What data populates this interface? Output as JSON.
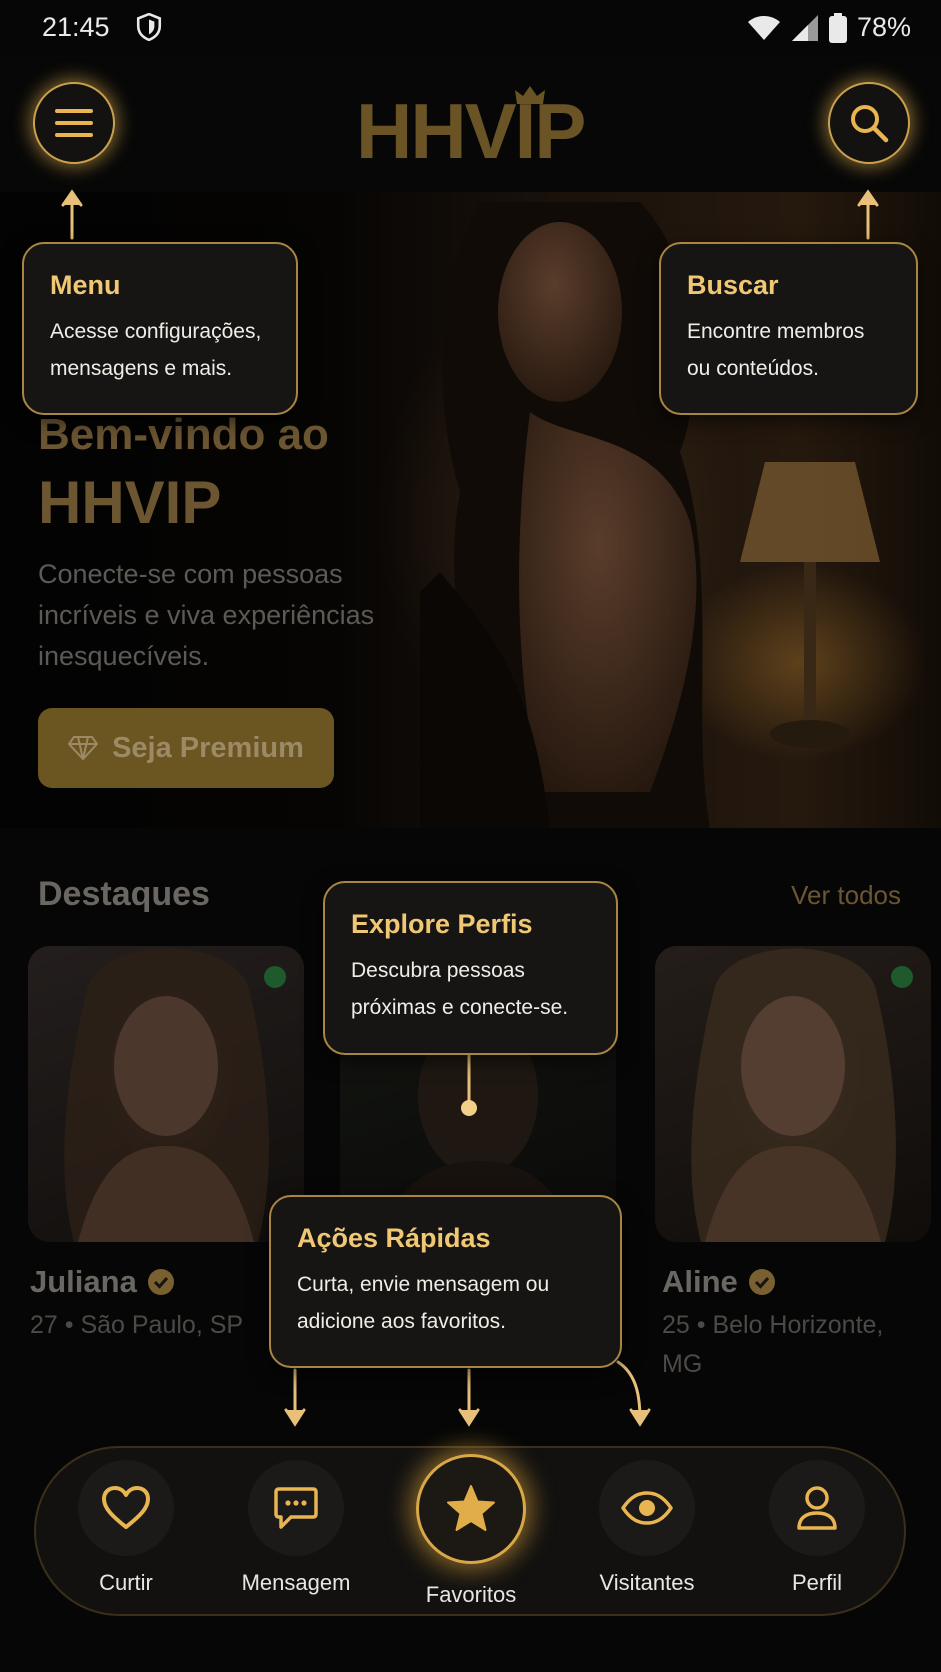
{
  "status_bar": {
    "time": "21:45",
    "battery": "78%"
  },
  "header": {
    "logo": "HHVIP",
    "menu_icon": "hamburger-icon",
    "search_icon": "search-icon"
  },
  "hero": {
    "title_line1": "Bem-vindo ao",
    "title_line2": "HHVIP",
    "subtitle": "Conecte-se com pessoas incríveis e viva experiências inesquecíveis.",
    "premium_button": "Seja Premium"
  },
  "highlights": {
    "title": "Destaques",
    "see_all": "Ver todos",
    "profiles": [
      {
        "name": "Juliana",
        "info": "27 • São Paulo, SP"
      },
      {
        "name": "Aline",
        "info": "25 • Belo Horizonte, MG"
      }
    ]
  },
  "tooltips": {
    "menu": {
      "title": "Menu",
      "body": "Acesse configurações, mensagens e mais."
    },
    "search": {
      "title": "Buscar",
      "body": "Encontre membros ou conteúdos."
    },
    "explore": {
      "title": "Explore Perfis",
      "body": "Descubra pessoas próximas e conecte-se."
    },
    "actions": {
      "title": "Ações Rápidas",
      "body": "Curta, envie mensagem ou adicione aos favoritos."
    }
  },
  "nav": {
    "items": [
      {
        "label": "Curtir",
        "icon": "heart-icon"
      },
      {
        "label": "Mensagem",
        "icon": "message-icon"
      },
      {
        "label": "Favoritos",
        "icon": "star-icon"
      },
      {
        "label": "Visitantes",
        "icon": "eye-icon"
      },
      {
        "label": "Perfil",
        "icon": "user-icon"
      }
    ]
  },
  "colors": {
    "accent": "#e8b550",
    "gold_dim": "#6b5631",
    "background": "#060606"
  }
}
